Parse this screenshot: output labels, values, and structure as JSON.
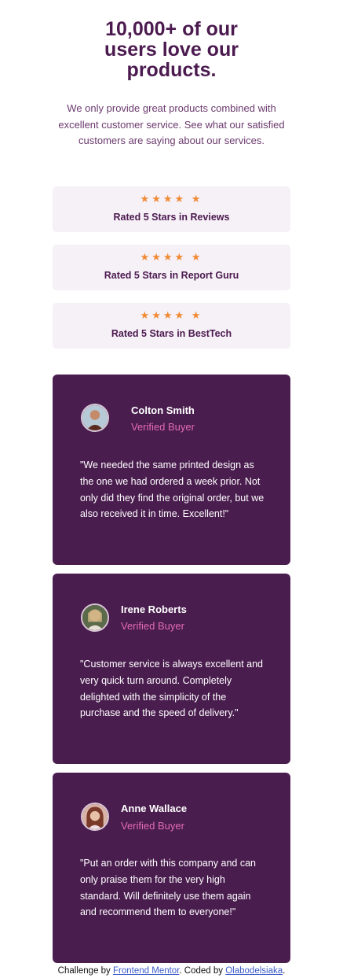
{
  "hero": {
    "title": "10,000+ of our users love our products.",
    "description": "We only provide great products combined with excellent customer service. See what our satisfied customers are saying about our services."
  },
  "ratings": [
    {
      "stars": "★★★★ ★",
      "label": "Rated 5 Stars in Reviews"
    },
    {
      "stars": "★★★★ ★",
      "label": "Rated 5 Stars in Report Guru"
    },
    {
      "stars": "★★★★ ★",
      "label": "Rated 5 Stars in BestTech"
    }
  ],
  "testimonials": [
    {
      "name": "Colton Smith",
      "status": "Verified Buyer",
      "quote": "\"We needed the same printed design as the one we had ordered a week prior. Not only did they find the original order, but we also received it in time. Excellent!\""
    },
    {
      "name": "Irene Roberts",
      "status": "Verified Buyer",
      "quote": "\"Customer service is always excellent and very quick turn around. Completely delighted with the simplicity of the purchase and the speed of delivery.\""
    },
    {
      "name": "Anne Wallace",
      "status": "Verified Buyer",
      "quote": "\"Put an order with this company and can only praise them for the very high standard. Will definitely use them again and recommend them to everyone!\""
    }
  ],
  "footer": {
    "prefix": "Challenge by",
    "link1": "Frontend Mentor",
    "middle": ". Coded by",
    "link2": "Olabodelsiaka",
    "suffix": "."
  },
  "colors": {
    "primary": "#4a1d4f",
    "accent_pink": "#e36bb3",
    "star_orange": "#f08a34",
    "rating_bg": "#f6f0f7"
  }
}
